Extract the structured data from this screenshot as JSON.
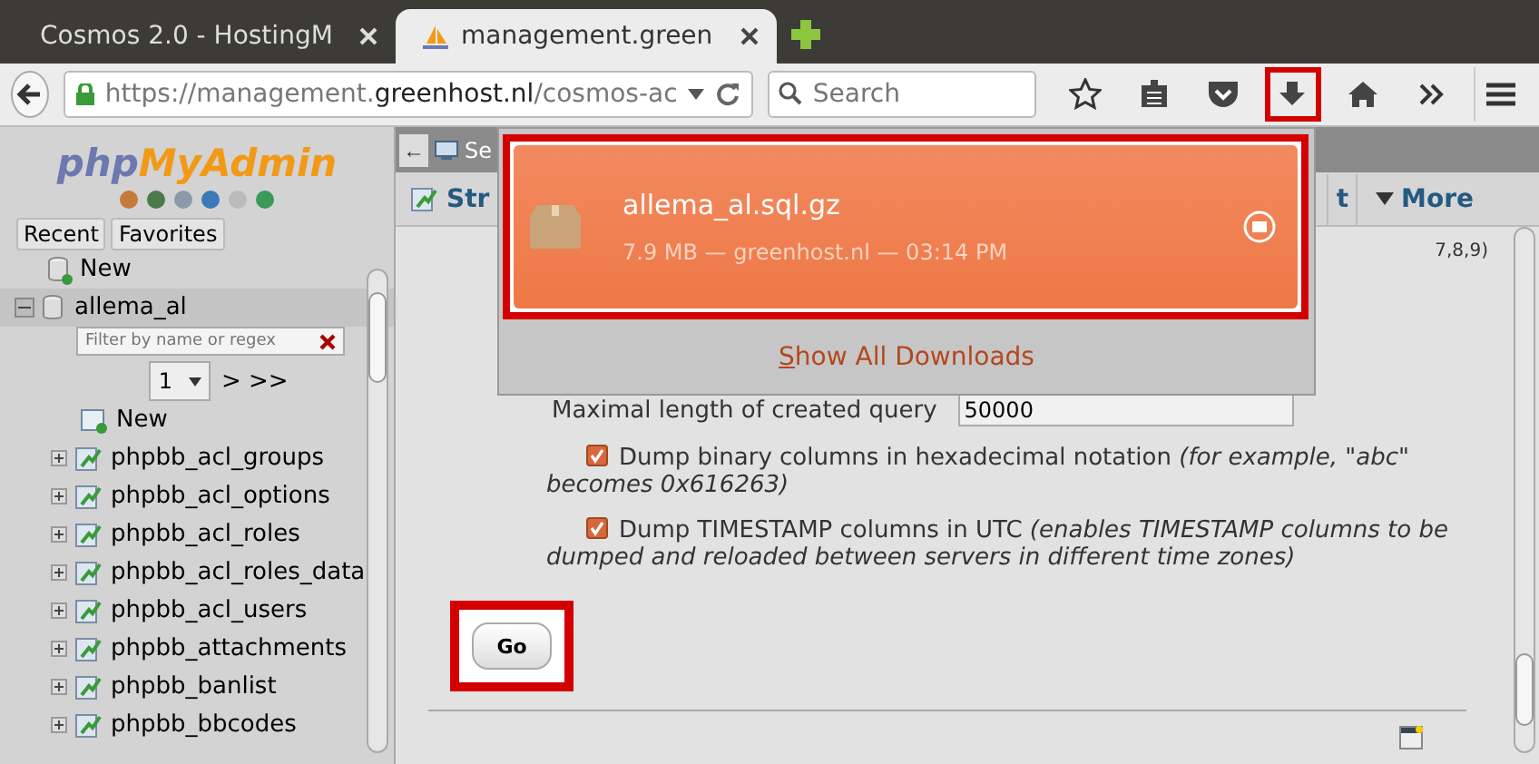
{
  "browser": {
    "tabs": [
      {
        "title": "Cosmos 2.0 - HostingM",
        "selected": false,
        "kind": "page"
      },
      {
        "title": "management.green",
        "selected": true,
        "kind": "pma"
      }
    ],
    "url_prefix": "https://management.",
    "url_host": "greenhost.nl",
    "url_rest": "/cosmos-ac",
    "search_placeholder": "Search",
    "downloads_highlighted": true
  },
  "sidebar": {
    "logo_php": "php",
    "logo_rest": "MyAdmin",
    "buttons": [
      "Recent",
      "Favorites"
    ],
    "new_database": "New",
    "database": {
      "name": "allema_al",
      "expanded": true,
      "filter_placeholder": "Filter by name or regex",
      "page": "1",
      "pager": "> >>",
      "new_table": "New",
      "tables": [
        "phpbb_acl_groups",
        "phpbb_acl_options",
        "phpbb_acl_roles",
        "phpbb_acl_roles_data",
        "phpbb_acl_users",
        "phpbb_attachments",
        "phpbb_banlist",
        "phpbb_bbcodes"
      ]
    }
  },
  "main": {
    "back": "←",
    "breadcrumb": "Se",
    "tabs": [
      {
        "label": "Str",
        "kind": "structure"
      },
      {
        "label": "t",
        "kind": "plain"
      },
      {
        "label": "More",
        "kind": "more"
      }
    ],
    "partial_text": "7,8,9)",
    "query_length_label": "Maximal length of created query",
    "query_length_value": "50000",
    "options": [
      {
        "label": "Dump binary columns in hexadecimal notation *(for example, \"abc\" becomes 0x616263)*",
        "checked": true
      },
      {
        "label": "Dump TIMESTAMP columns in UTC *(enables TIMESTAMP columns to be dumped and reloaded between servers in different time zones)*",
        "checked": true
      }
    ],
    "go": "Go",
    "go_highlighted": true
  },
  "downloads": {
    "file": "allema_al.sql.gz",
    "details": "7.9 MB — greenhost.nl — 03:14 PM",
    "highlighted": true,
    "show_all": "Show All Downloads"
  }
}
